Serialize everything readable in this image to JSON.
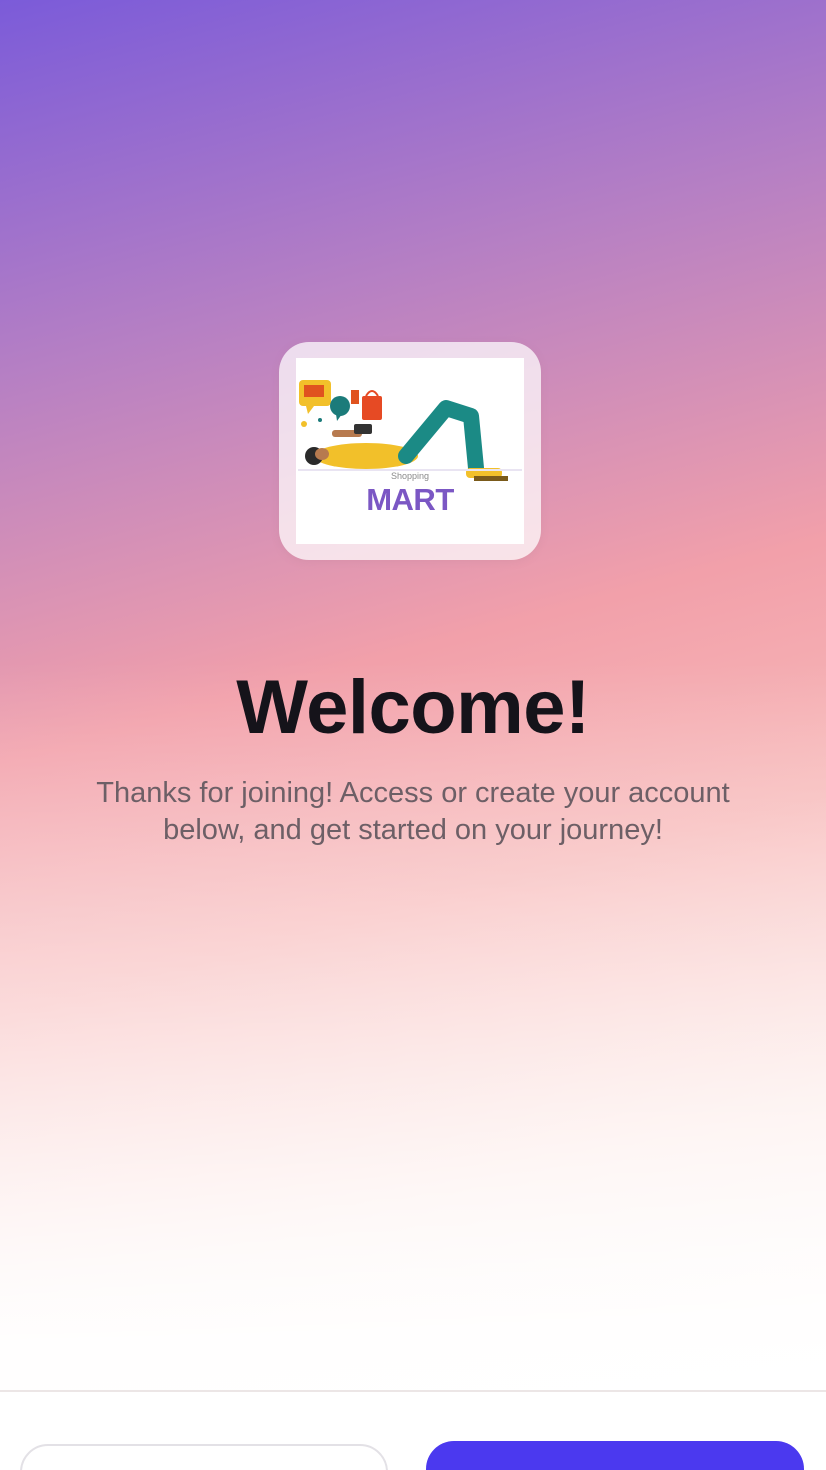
{
  "welcome": {
    "title": "Welcome!",
    "subtitle": "Thanks for joining! Access or create your account below, and get started on your journey!"
  },
  "logo": {
    "brand_text": "MART",
    "small_text": "Shopping",
    "illustration": "person-lying-with-shopping-bags"
  },
  "actions": {
    "secondary_label": "",
    "primary_label": ""
  },
  "colors": {
    "gradient_top": "#7b5bd9",
    "gradient_mid": "#f2a0aa",
    "brand_purple": "#7b57c4",
    "primary_button": "#4b39ef"
  }
}
